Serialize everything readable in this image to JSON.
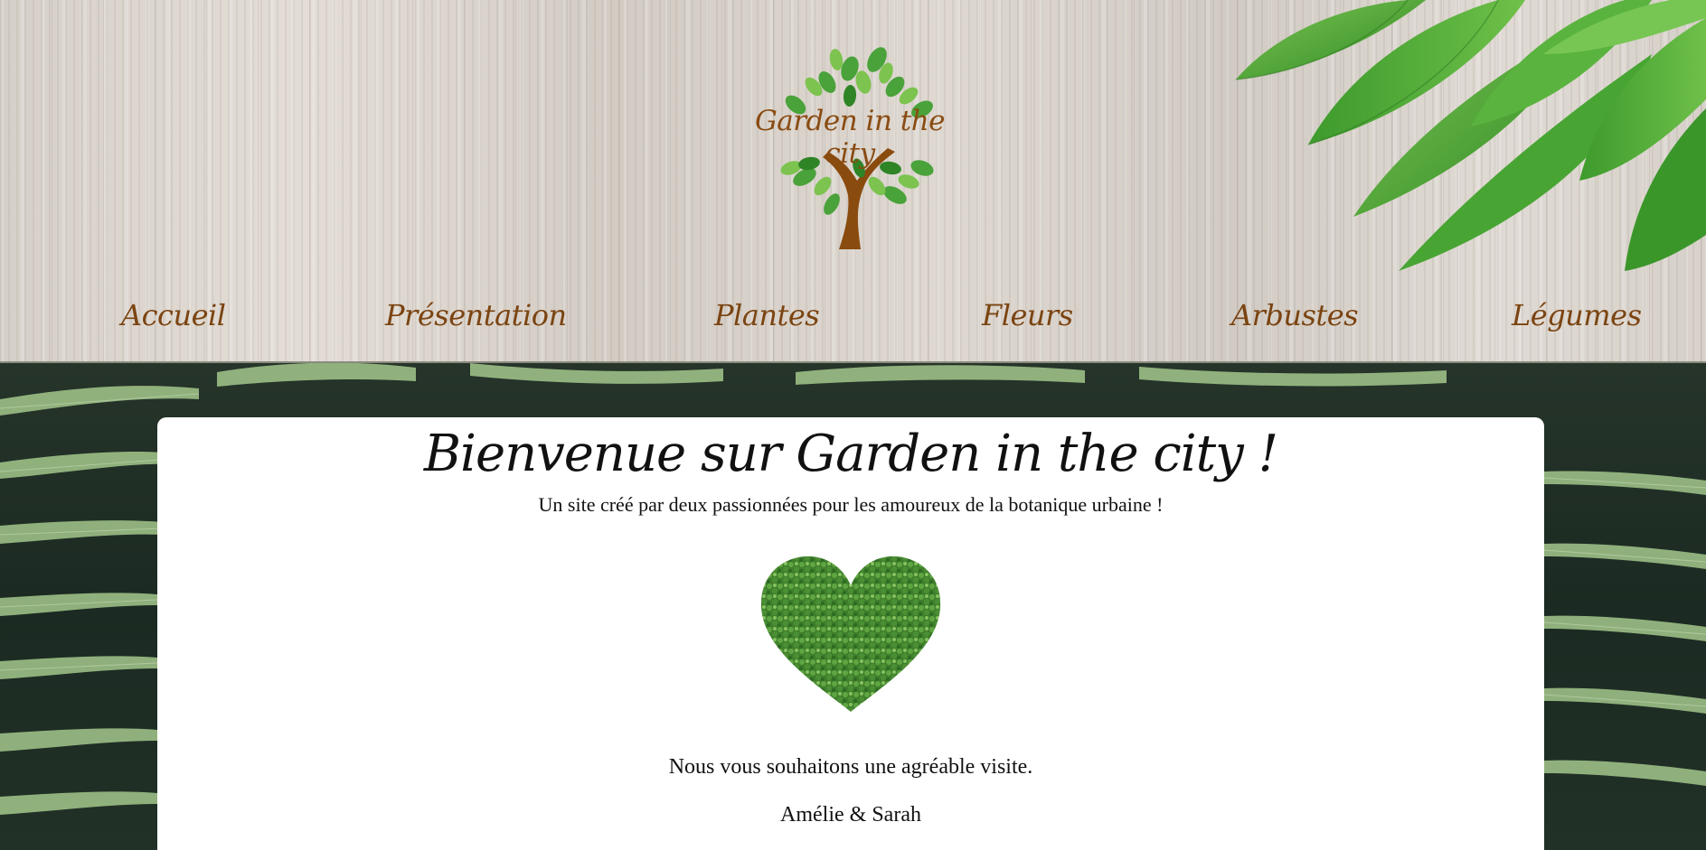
{
  "site": {
    "logo_text": "Garden in the city"
  },
  "nav": {
    "items": [
      {
        "label": "Accueil"
      },
      {
        "label": "Présentation"
      },
      {
        "label": "Plantes"
      },
      {
        "label": "Fleurs"
      },
      {
        "label": "Arbustes"
      },
      {
        "label": "Légumes"
      }
    ]
  },
  "main": {
    "title": "Bienvenue sur Garden in the city !",
    "subtitle": "Un site créé par deux passionnées pour les amoureux de la botanique urbaine !",
    "message": "Nous vous souhaitons une agréable visite.",
    "signature": "Amélie & Sarah"
  },
  "colors": {
    "nav_text": "#7b4411",
    "logo_text": "#8a4b12",
    "card_bg": "#ffffff",
    "leaf_green": "#4fa83a"
  }
}
